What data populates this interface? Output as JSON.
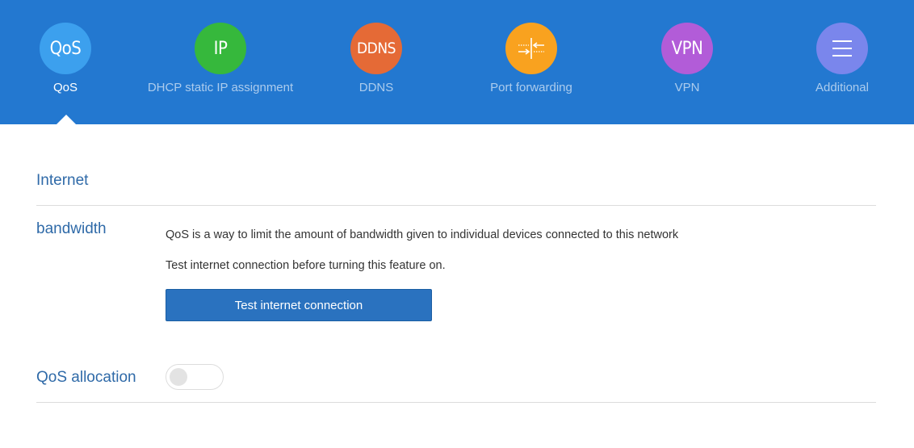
{
  "nav": {
    "items": [
      {
        "icon_text": "QoS",
        "label": "QoS",
        "color": "#3ca0ee",
        "active": true
      },
      {
        "icon_text": "IP",
        "label": "DHCP static IP assignment",
        "color": "#36b83c"
      },
      {
        "icon_text": "DDNS",
        "label": "DDNS",
        "color": "#e56a36"
      },
      {
        "icon": "port-forwarding-icon",
        "label": "Port forwarding",
        "color": "#f9a21f"
      },
      {
        "icon_text": "VPN",
        "label": "VPN",
        "color": "#b25cd8"
      },
      {
        "icon": "menu-icon",
        "label": "Additional",
        "color": "#7a86ec"
      }
    ]
  },
  "internet_section": {
    "title": "Internet"
  },
  "bandwidth_section": {
    "title": "bandwidth",
    "description": "QoS is a way to limit the amount of bandwidth given to individual devices connected to this network",
    "note": "Test internet connection before turning this feature on.",
    "test_button_label": "Test internet connection"
  },
  "qos_allocation": {
    "title": "QoS allocation",
    "enabled": false
  },
  "colors": {
    "header": "#2378d0",
    "accent_text": "#2f6aa8",
    "button": "#2a72bf"
  }
}
